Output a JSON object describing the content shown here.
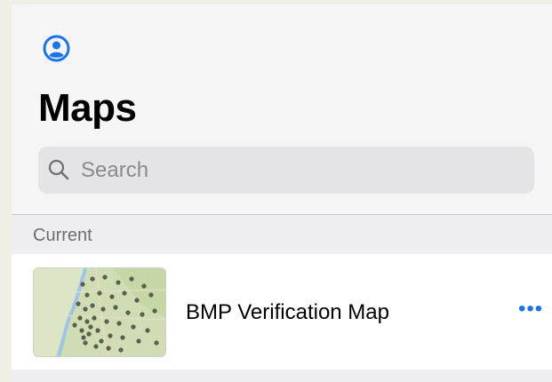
{
  "header": {
    "avatar_icon": "person-circle-icon",
    "title": "Maps"
  },
  "search": {
    "placeholder": "Search",
    "value": "",
    "icon": "search-icon"
  },
  "sections": [
    {
      "label": "Current",
      "items": [
        {
          "title": "BMP Verification Map",
          "thumbnail_icon": "map-thumbnail",
          "menu_icon": "more-ellipsis-icon",
          "menu_glyph": "•••"
        }
      ]
    }
  ],
  "colors": {
    "accent": "#1a73e8",
    "background": "#f5f5f6",
    "section_header": "#eeeef0",
    "search_field": "#e4e4e6"
  }
}
